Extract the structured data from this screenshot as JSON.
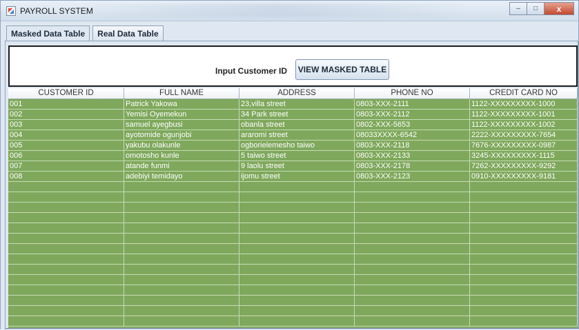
{
  "window": {
    "title": "PAYROLL SYSTEM",
    "minimize": "–",
    "maximize": "□",
    "close": "x"
  },
  "tabs": [
    {
      "label": "Masked Data Table",
      "active": true
    },
    {
      "label": "Real Data Table",
      "active": false
    }
  ],
  "search": {
    "label": "Input Customer ID",
    "button_label": "VIEW MASKED TABLE"
  },
  "table": {
    "columns": [
      "CUSTOMER ID",
      "FULL NAME",
      "ADDRESS",
      "PHONE NO",
      "CREDIT CARD NO"
    ],
    "rows": [
      [
        "001",
        "Patrick Yakowa",
        "23,villa street",
        "0803-XXX-2111",
        "1122-XXXXXXXXX-1000"
      ],
      [
        "002",
        "Yemisi Oyemekun",
        "34 Park street",
        "0803-XXX-2112",
        "1122-XXXXXXXXX-1001"
      ],
      [
        "003",
        "samuel ayegbusi",
        "obanla street",
        "0802-XXX-5653",
        "1122-XXXXXXXXX-1002"
      ],
      [
        "004",
        "ayotomide ogunjobi",
        "araromi street",
        "08033XXXX-6542",
        "2222-XXXXXXXXX-7654"
      ],
      [
        "005",
        "yakubu olakunle",
        "ogborielemesho taiwo",
        "0803-XXX-2118",
        "7676-XXXXXXXXX-0987"
      ],
      [
        "006",
        "omotosho kunle",
        "5 taiwo street",
        "0803-XXX-2133",
        "3245-XXXXXXXXX-1115"
      ],
      [
        "007",
        "atande funmi",
        "9 laolu street",
        "0803-XXX-2178",
        "7262-XXXXXXXXX-9292"
      ],
      [
        "008",
        "adebiyi temidayo",
        "ijomu street",
        "0803-XXX-2123",
        "0910-XXXXXXXXX-9181"
      ]
    ],
    "empty_rows": 14
  },
  "colors": {
    "row_bg": "#7fa85c",
    "row_line": "#c8dcb8",
    "title_bar": "#dfe8f2",
    "close_button": "#c24a2f"
  }
}
